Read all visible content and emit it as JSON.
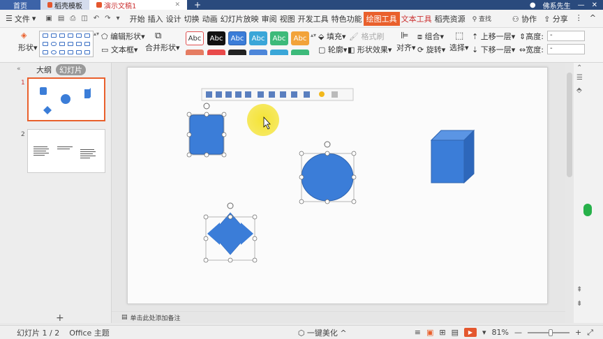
{
  "tabs": {
    "home": "首页",
    "doc1": "稻壳模板",
    "doc2": "演示文稿1",
    "new_tab": "+",
    "user": "佛系先生"
  },
  "menubar": {
    "file": "文件",
    "items": [
      "开始",
      "插入",
      "设计",
      "切换",
      "动画",
      "幻灯片放映",
      "审阅",
      "视图",
      "开发工具",
      "特色功能",
      "绘图工具",
      "文本工具",
      "稻壳资源"
    ],
    "active_index": 10,
    "search": "查找",
    "collab": "协作",
    "share": "分享"
  },
  "ribbon": {
    "shape_label": "形状",
    "edit_shape": "编辑形状",
    "text_box": "文本框",
    "merge_shape": "合并形状",
    "style_text": "Abc",
    "fill": "填充",
    "format_brush": "格式刷",
    "outline": "轮廓",
    "shape_effect": "形状效果",
    "align": "对齐",
    "group": "组合",
    "rotate": "旋转",
    "select": "选择",
    "bring_forward": "上移一层",
    "send_backward": "下移一层",
    "height_label": "高度:",
    "width_label": "宽度:",
    "height_value": "-",
    "width_value": "-"
  },
  "leftpanel": {
    "tab_outline": "大纲",
    "tab_slides": "幻灯片",
    "slide1_num": "1",
    "slide2_num": "2",
    "add_slide": "+"
  },
  "notes": "单击此处添加备注",
  "statusbar": {
    "slide_info": "幻灯片 1 / 2",
    "theme": "Office 主题",
    "beautify": "一键美化",
    "zoom": "81%",
    "zoom_fraction": 0.55
  },
  "colors": {
    "accent": "#e9602c",
    "shape_fill": "#3b7dd8",
    "shape_stroke": "#2f64b0",
    "cursor_highlight": "#f4e22a"
  }
}
